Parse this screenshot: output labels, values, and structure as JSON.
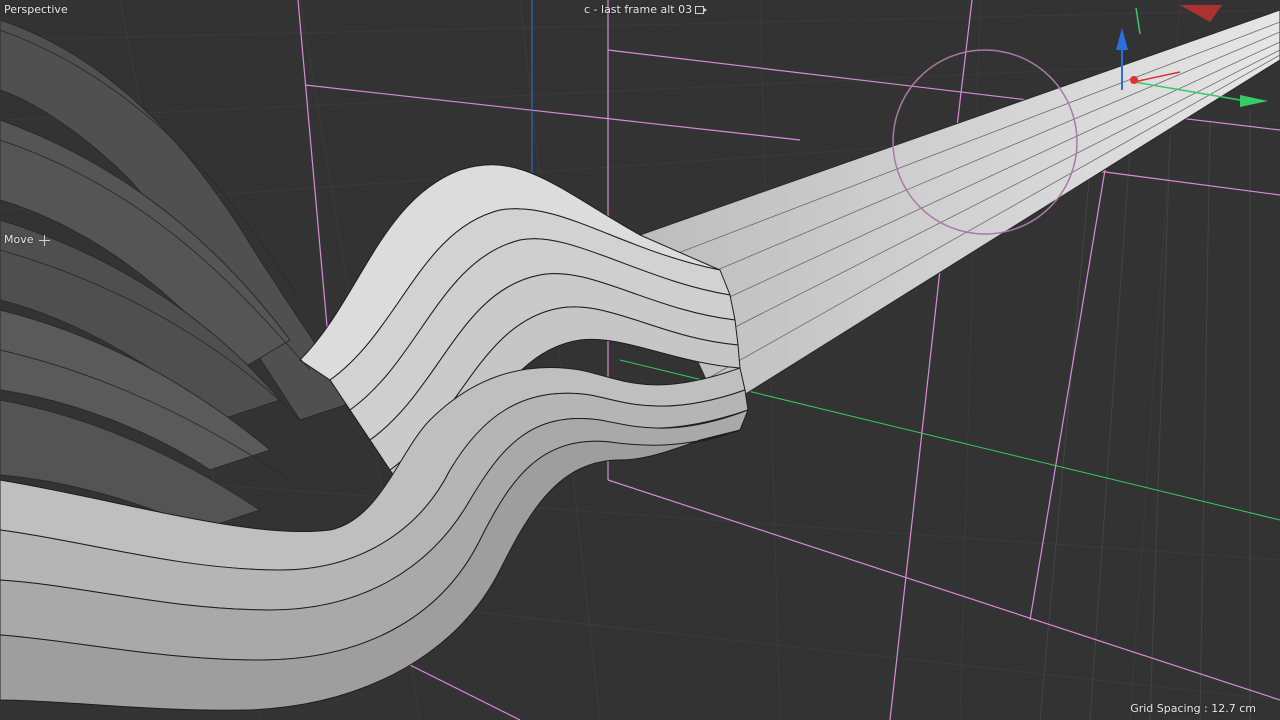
{
  "viewport": {
    "view_name": "Perspective",
    "camera_title": "c - last frame alt 03",
    "active_tool": "Move",
    "grid_info": "Grid Spacing : 12.7 cm"
  },
  "icons": {
    "camera": "camera-icon",
    "move": "move-icon"
  },
  "colors": {
    "background": "#333333",
    "grid_line": "#3a3a3a",
    "bounding_box": "#d98bd9",
    "surface_light": "#d6d6d6",
    "surface_dark": "#4c4c4c",
    "axis_x": "#e03030",
    "axis_y": "#2a6fe0",
    "axis_z": "#33cc66"
  }
}
